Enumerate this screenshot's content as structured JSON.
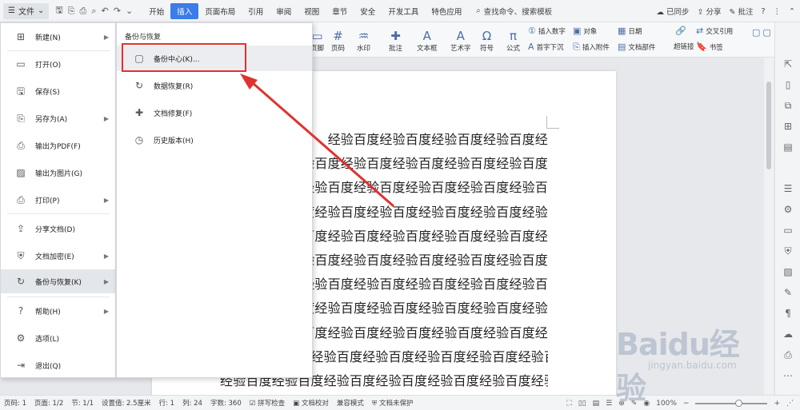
{
  "titlebar": {
    "file_label": "文件",
    "tabs": [
      "开始",
      "插入",
      "页面布局",
      "引用",
      "审阅",
      "视图",
      "章节",
      "安全",
      "开发工具",
      "特色应用"
    ],
    "active_tab": "插入",
    "search_label": "查找命令、搜索模板",
    "sync_label": "已同步",
    "share_label": "分享",
    "comment_label": "批注"
  },
  "ribbon": {
    "items": [
      {
        "label": "页脚",
        "icon": "footer-icon"
      },
      {
        "label": "页码",
        "icon": "page-number-icon"
      },
      {
        "label": "水印",
        "icon": "watermark-icon"
      },
      {
        "label": "批注",
        "icon": "comment-icon"
      },
      {
        "label": "文本框",
        "icon": "textbox-icon"
      },
      {
        "label": "艺术字",
        "icon": "wordart-icon"
      },
      {
        "label": "符号",
        "icon": "symbol-icon"
      },
      {
        "label": "公式",
        "icon": "formula-icon"
      }
    ],
    "small": {
      "insert_number": "插入数字",
      "object": "对象",
      "date": "日期",
      "drop_cap": "首字下沉",
      "insert_attachment": "插入附件",
      "doc_parts": "文档部件",
      "cross_ref": "交叉引用",
      "hyperlink": "超链接",
      "bookmark": "书签"
    }
  },
  "file_menu": {
    "items": [
      {
        "label": "新建(N)",
        "icon": "new-doc-icon",
        "arrow": true
      },
      {
        "label": "打开(O)",
        "icon": "folder-open-icon",
        "arrow": false
      },
      {
        "label": "保存(S)",
        "icon": "save-icon",
        "arrow": false
      },
      {
        "label": "另存为(A)",
        "icon": "save-as-icon",
        "arrow": true
      },
      {
        "label": "输出为PDF(F)",
        "icon": "pdf-icon",
        "arrow": false
      },
      {
        "label": "输出为图片(G)",
        "icon": "image-icon",
        "arrow": false
      },
      {
        "label": "打印(P)",
        "icon": "print-icon",
        "arrow": true
      },
      {
        "label": "分享文档(D)",
        "icon": "share-icon",
        "arrow": false
      },
      {
        "label": "文档加密(E)",
        "icon": "encrypt-icon",
        "arrow": true
      },
      {
        "label": "备份与恢复(K)",
        "icon": "backup-icon",
        "arrow": true
      },
      {
        "label": "帮助(H)",
        "icon": "help-icon",
        "arrow": true
      },
      {
        "label": "选项(L)",
        "icon": "settings-icon",
        "arrow": false
      },
      {
        "label": "退出(Q)",
        "icon": "exit-icon",
        "arrow": false
      }
    ]
  },
  "submenu": {
    "title": "备份与恢复",
    "items": [
      {
        "label": "备份中心(K)...",
        "icon": "backup-center-icon"
      },
      {
        "label": "数据恢复(R)",
        "icon": "data-recovery-icon"
      },
      {
        "label": "文档修复(F)",
        "icon": "doc-repair-icon"
      },
      {
        "label": "历史版本(H)",
        "icon": "history-icon"
      }
    ]
  },
  "document": {
    "lines": [
      "经验百度经验百度经验百度经验百度经",
      "验百度经验百度经验百度经验百度经验百度",
      "度经验百度经验百度经验百度经验百度经验百",
      "百度经验百度经验百度经验百度经验百度经验",
      "经验百度经验百度经验百度经验百度经验百度经",
      "验百度经验百度经验百度经验百度经验百度经验百度",
      "度经验百度经验百度经验百度经验百度经验百度经验百",
      "百度经验百度经验百度经验百度经验百度经验百度经验",
      "经验百度经验百度经验百度经验百度经验百度经验百度经",
      "验百度经验百度经验百度经验百度经验百度经验百度经验百度",
      "经验百度经验百度经验百度经验百度经验百度经验百度经验百"
    ]
  },
  "statusbar": {
    "page_code": "页码: 1",
    "page": "页面: 1/2",
    "section": "节: 1/1",
    "setting": "设置值: 2.5厘米",
    "row": "行: 1",
    "col": "列: 24",
    "word_count": "字数: 360",
    "spell_check": "拼写检查",
    "doc_proof": "文档校对",
    "compat_mode": "兼容模式",
    "doc_protect": "文档未保护",
    "zoom": "100%"
  },
  "watermark": {
    "brand": "Baidu经验",
    "url": "jingyan.baidu.com"
  },
  "colors": {
    "accent": "#3b7bea",
    "highlight": "#e0322f"
  }
}
